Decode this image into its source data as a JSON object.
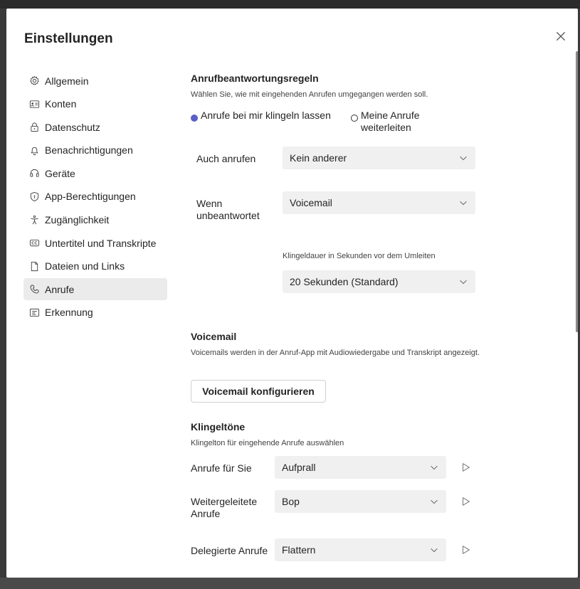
{
  "dialog": {
    "title": "Einstellungen",
    "close_icon": "close-icon"
  },
  "sidebar": {
    "items": [
      {
        "label": "Allgemein",
        "icon": "gear-icon",
        "active": false
      },
      {
        "label": "Konten",
        "icon": "id-card-icon",
        "active": false
      },
      {
        "label": "Datenschutz",
        "icon": "lock-icon",
        "active": false
      },
      {
        "label": "Benachrichtigungen",
        "icon": "bell-icon",
        "active": false
      },
      {
        "label": "Geräte",
        "icon": "headset-icon",
        "active": false
      },
      {
        "label": "App-Berechtigungen",
        "icon": "shield-icon",
        "active": false
      },
      {
        "label": "Zugänglichkeit",
        "icon": "accessibility-icon",
        "active": false
      },
      {
        "label": "Untertitel und Transkripte",
        "icon": "cc-icon",
        "active": false
      },
      {
        "label": "Dateien und Links",
        "icon": "document-icon",
        "active": false
      },
      {
        "label": "Anrufe",
        "icon": "phone-icon",
        "active": true
      },
      {
        "label": "Erkennung",
        "icon": "recognition-icon",
        "active": false
      }
    ]
  },
  "answer_rules": {
    "heading": "Anrufbeantwortungsregeln",
    "description": "Wählen Sie, wie mit eingehenden Anrufen umgegangen werden soll.",
    "option_ring": "Anrufe bei mir klingeln lassen",
    "option_forward": "Meine Anrufe weiterleiten",
    "selected": "option_ring",
    "also_ring_label": "Auch anrufen",
    "also_ring_value": "Kein anderer",
    "unanswered_label": "Wenn unbeantwortet",
    "unanswered_value": "Voicemail",
    "ring_duration_caption": "Klingeldauer in Sekunden vor dem Umleiten",
    "ring_duration_value": "20 Sekunden (Standard)"
  },
  "voicemail": {
    "heading": "Voicemail",
    "description": "Voicemails werden in der Anruf-App mit Audiowiedergabe und Transkript angezeigt.",
    "configure_button": "Voicemail konfigurieren"
  },
  "ringtones": {
    "heading": "Klingeltöne",
    "description": "Klingelton für eingehende Anrufe auswählen",
    "rows": [
      {
        "label": "Anrufe für Sie",
        "value": "Aufprall"
      },
      {
        "label": "Weitergeleitete Anrufe",
        "value": "Bop"
      },
      {
        "label": "Delegierte Anrufe",
        "value": "Flattern"
      }
    ]
  },
  "colors": {
    "accent": "#5b5fc7",
    "field_bg": "#f0f0f0",
    "active_nav_bg": "#ebebeb"
  }
}
